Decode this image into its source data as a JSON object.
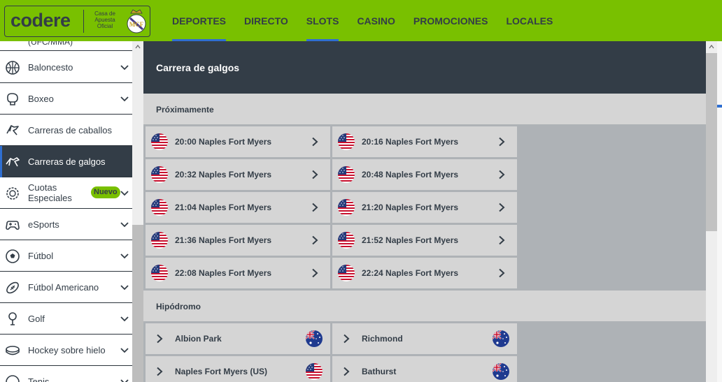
{
  "header": {
    "logo_text": "codere",
    "logo_subtitle_1": "Casa de",
    "logo_subtitle_2": "Apuesta",
    "logo_subtitle_3": "Oficial",
    "nav": [
      {
        "label": "DEPORTES",
        "active": true
      },
      {
        "label": "DIRECTO",
        "active": false
      },
      {
        "label": "SLOTS",
        "active": true
      },
      {
        "label": "CASINO",
        "active": false
      },
      {
        "label": "PROMOCIONES",
        "active": false
      },
      {
        "label": "LOCALES",
        "active": false
      }
    ]
  },
  "sidebar": {
    "partial_top_label": "(UFC/MMA)",
    "items": [
      {
        "label": "Baloncesto",
        "icon": "basketball-icon"
      },
      {
        "label": "Boxeo",
        "icon": "boxing-glove-icon"
      },
      {
        "label": "Carreras de caballos",
        "icon": "horse-icon"
      },
      {
        "label": "Carreras de galgos",
        "icon": "greyhound-icon",
        "selected": true
      },
      {
        "label": "Cuotas Especiales",
        "icon": "special-odds-icon",
        "badge": "Nuevo"
      },
      {
        "label": "eSports",
        "icon": "gamepad-icon"
      },
      {
        "label": "Fútbol",
        "icon": "soccer-ball-icon"
      },
      {
        "label": "Fútbol Americano",
        "icon": "american-football-icon"
      },
      {
        "label": "Golf",
        "icon": "golf-icon"
      },
      {
        "label": "Hockey sobre hielo",
        "icon": "hockey-puck-icon"
      },
      {
        "label": "Tenis",
        "icon": "tennis-icon"
      }
    ]
  },
  "main": {
    "title": "Carrera de galgos",
    "upcoming_heading": "Próximamente",
    "upcoming": [
      {
        "time": "20:00",
        "track": "Naples Fort Myers",
        "flag": "usa-flag-icon"
      },
      {
        "time": "20:16",
        "track": "Naples Fort Myers",
        "flag": "usa-flag-icon"
      },
      {
        "time": "20:32",
        "track": "Naples Fort Myers",
        "flag": "usa-flag-icon"
      },
      {
        "time": "20:48",
        "track": "Naples Fort Myers",
        "flag": "usa-flag-icon"
      },
      {
        "time": "21:04",
        "track": "Naples Fort Myers",
        "flag": "usa-flag-icon"
      },
      {
        "time": "21:20",
        "track": "Naples Fort Myers",
        "flag": "usa-flag-icon"
      },
      {
        "time": "21:36",
        "track": "Naples Fort Myers",
        "flag": "usa-flag-icon"
      },
      {
        "time": "21:52",
        "track": "Naples Fort Myers",
        "flag": "usa-flag-icon"
      },
      {
        "time": "22:08",
        "track": "Naples Fort Myers",
        "flag": "usa-flag-icon"
      },
      {
        "time": "22:24",
        "track": "Naples Fort Myers",
        "flag": "usa-flag-icon"
      }
    ],
    "tracks_heading": "Hipódromo",
    "tracks": [
      {
        "name": "Albion Park",
        "flag": "australia-flag-icon"
      },
      {
        "name": "Richmond",
        "flag": "australia-flag-icon"
      },
      {
        "name": "Naples Fort Myers (US)",
        "flag": "usa-flag-icon"
      },
      {
        "name": "Bathurst",
        "flag": "australia-flag-icon"
      }
    ]
  },
  "colors": {
    "brand_green": "#79c000",
    "dark_slate": "#333d47",
    "accent_blue": "#2f6fd1",
    "card_grey": "#d5d5d5"
  }
}
